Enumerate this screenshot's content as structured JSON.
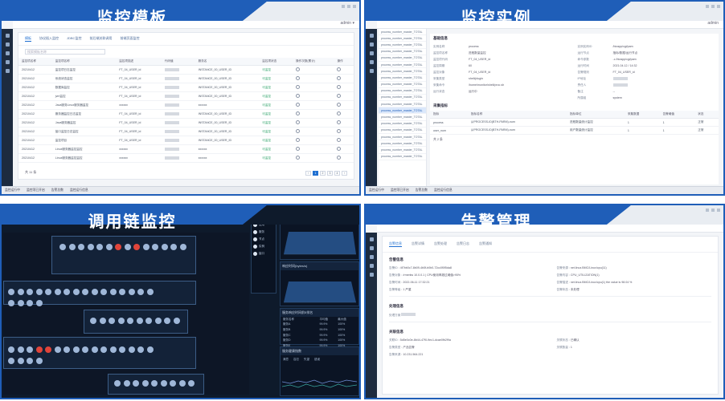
{
  "panels": {
    "template": {
      "title": "监控模板",
      "user": "admin ▾",
      "tabs": [
        "模板",
        "协议插入监控",
        "JDBC监控",
        "前后端关联调用",
        "前端页面监控"
      ],
      "search_placeholder": "搜索模板名称",
      "columns": [
        "监控项名称",
        "监控项名称",
        "监控项描述",
        "代码值",
        "服务名",
        "监控项状态",
        "操作次数(累计)",
        "操作"
      ],
      "rows": [
        [
          "20210412",
          "监控项日志监控",
          "FT_04_USER_id",
          "",
          "INSTANCE_00_USER_ID",
          "可监控"
        ],
        [
          "20210412",
          "系统状态监控",
          "FT_04_USER_id",
          "",
          "INSTANCE_00_USER_ID",
          "可监控"
        ],
        [
          "20210412",
          "数据库监控",
          "FT_04_USER_id",
          "",
          "INSTANCE_00_USER_ID",
          "可监控"
        ],
        [
          "20210412",
          "jvm监控",
          "FT_04_USER_id",
          "",
          "INSTANCE_00_USER_ID",
          "可监控"
        ],
        [
          "20210412",
          "Java服务Linux服务器监控",
          "xxxxxx",
          "",
          "xxxxxx",
          "可监控"
        ],
        [
          "20210412",
          "服务器监控日志监控",
          "FT_04_USER_id",
          "",
          "INSTANCE_00_USER_ID",
          "可监控"
        ],
        [
          "20210412",
          "Java服务器监控",
          "FT_04_USER_id",
          "",
          "INSTANCE_00_USER_ID",
          "可监控"
        ],
        [
          "20210412",
          "接口监控日志监控",
          "FT_04_USER_id",
          "",
          "INSTANCE_00_USER_ID",
          "可监控"
        ],
        [
          "20210412",
          "监控项目",
          "FT_04_USER_id",
          "",
          "INSTANCE_00_USER_ID",
          "可监控"
        ],
        [
          "20210412",
          "Linux服务器监控监控",
          "xxxxxx",
          "",
          "xxxxxx",
          "可监控"
        ],
        [
          "20210412",
          "Linux服务器监控监控",
          "xxxxxx",
          "",
          "xxxxxx",
          "可监控"
        ]
      ],
      "total": "共 11 条",
      "pages": [
        "‹",
        "1",
        "2",
        "3",
        "4",
        "›"
      ],
      "status_items": [
        "监控运行中",
        "监控项已开启",
        "告警总数",
        "监控运行信息"
      ]
    },
    "instance": {
      "title": "监控实例",
      "user": "admin",
      "list_items": [
        "process_number_master_TOTAL",
        "process_number_master_TOTAL",
        "process_number_master_TOTAL",
        "process_number_master_TOTAL",
        "process_number_master_TOTAL",
        "process_number_master_TOTAL",
        "process_number_master_TOTAL",
        "process_number_master_TOTAL",
        "process_number_master_TOTAL",
        "process_number_master_TOTAL",
        "process_number_master_TOTAL",
        "process_number_master_TOTAL",
        "process_number_master_TOTAL",
        "process_number_master_TOTAL",
        "process_number_master_TOTAL",
        "process_number_master_TOTAL",
        "process_number_master_TOTAL",
        "process_number_master_TOTAL",
        "process_number_master_TOTAL",
        "process_number_master_TOTAL"
      ],
      "selected_index": 12,
      "sec_basic": "基础信息",
      "left_kv": [
        [
          "实例名称",
          "process"
        ],
        [
          "监控项名称",
          "进程数量监控"
        ],
        [
          "监控项代码",
          "FT_04_USER_id"
        ],
        [
          "监控周期",
          "60"
        ],
        [
          "监控对象",
          "FT_04_USER_id"
        ],
        [
          "采集类型",
          "shell/plugin"
        ],
        [
          "采集命令",
          "/home/monitor/shell/proc.sh"
        ],
        [
          "运行状态",
          "运行中"
        ]
      ],
      "right_kv": [
        [
          "实例实例ID",
          "/bizapp/cgi/pam"
        ],
        [
          "运行节点",
          "指标/数据/运行节点"
        ],
        [
          "命令参数",
          "-c /bizapp/cgi/pam"
        ],
        [
          "运行时间",
          "2021.04.12 / 14:32"
        ],
        [
          "告警规则",
          "FT_04_USER_id"
        ],
        [
          "IP地址",
          ""
        ],
        [
          "责任人",
          ""
        ],
        [
          "备注",
          "--"
        ],
        [
          "所属组",
          "system"
        ]
      ],
      "sec_metrics": "采集指标",
      "metric_columns": [
        "指标",
        "指标名称",
        "指标单位",
        "采集数据",
        "告警阈值",
        "状态"
      ],
      "metric_rows": [
        [
          "process",
          "从PROCESS-ID(BTH-PARM)-num",
          "进程数量统计监控",
          "1",
          "1",
          "正常"
        ],
        [
          "user_num",
          "从PROCESS-ID(BTH-PARM)-num",
          "用户数量统计监控",
          "1",
          "1",
          "正常"
        ]
      ],
      "metric_total": "共 2 条",
      "status_items": [
        "监控运行中",
        "监控项已开启",
        "告警总数",
        "监控运行信息"
      ]
    },
    "trace": {
      "title": "调用链监控",
      "tree_items": [
        "全部",
        "应用",
        "服务",
        "节点",
        "实例",
        "接口"
      ],
      "throughput_title": "吞吐量(bytes/s)",
      "throughput_value": "Update 00:00:00",
      "response_title": "响应时间(bytes/s)",
      "table_title": "服务响应时间前5排名",
      "table_rows": [
        [
          "服务名称",
          "平均值",
          "最大值"
        ],
        [
          "服务A",
          "99.9%",
          "100%"
        ],
        [
          "服务B",
          "99.9%",
          "100%"
        ],
        [
          "服务C",
          "99.9%",
          "100%"
        ],
        [
          "服务D",
          "99.9%",
          "100%"
        ],
        [
          "服务E",
          "99.9%",
          "100%"
        ]
      ],
      "apdex_title": "服务健康指数",
      "apdex_labels": [
        "满意",
        "容忍",
        "失望",
        "错误"
      ]
    },
    "alarm": {
      "title": "告警管理",
      "tabs": [
        "告警信息",
        "告警详情",
        "告警处理",
        "告警日志",
        "告警通知"
      ],
      "sec_basic": "告警信息",
      "basic_left": [
        [
          "告警ID",
          "4f7bb0c7-8b09-4b5f-b0b0-72cc0f0f5da8"
        ],
        [
          "告警对象",
          "/rmerkw 10.0.0.1 | CPU使用率超过阈值>95%"
        ],
        [
          "告警时间",
          "2022-06-11 17:32:21"
        ],
        [
          "告警等级",
          "1 严重"
        ]
      ],
      "basic_right": [
        [
          "告警来源",
          "net.linux.BMC/Linux/cpu(11)"
        ],
        [
          "告警内容",
          "CPU_UTILIZATION(1)"
        ],
        [
          "告警描述",
          "net.linux.BMC/Linux/cpu(1) the value is 98.04 %"
        ],
        [
          "告警状态",
          "未处理"
        ]
      ],
      "sec_handle": "处理信息",
      "handle_label": "处理方案",
      "sec_link": "关联信息",
      "link_left": [
        [
          "关联ID",
          "5d5e0c0e-8b44-47f0-9ec1-dcae0fb2f9a"
        ],
        [
          "告警类型",
          "产品告警"
        ],
        [
          "告警来源",
          "10.231.564.221"
        ]
      ],
      "link_right": [
        [
          "关联状态",
          "已确认"
        ],
        [
          "关联数量",
          "1"
        ]
      ]
    }
  }
}
